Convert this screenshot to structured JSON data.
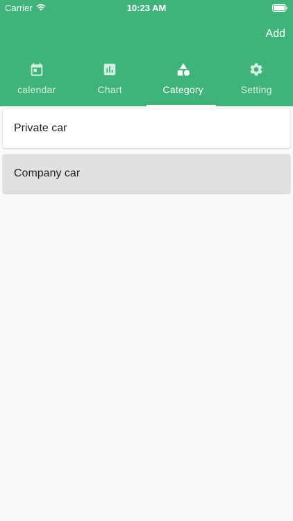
{
  "status_bar": {
    "carrier": "Carrier",
    "time": "10:23 AM"
  },
  "toolbar": {
    "add_label": "Add"
  },
  "tabs": [
    {
      "label": "calendar",
      "icon": "calendar-icon",
      "active": false
    },
    {
      "label": "Chart",
      "icon": "bar-chart-icon",
      "active": false
    },
    {
      "label": "Category",
      "icon": "shapes-icon",
      "active": true
    },
    {
      "label": "Setting",
      "icon": "gear-icon",
      "active": false
    }
  ],
  "categories": [
    {
      "label": "Private car",
      "selected": false
    },
    {
      "label": "Company car",
      "selected": true
    }
  ],
  "colors": {
    "header": "#3fb37a",
    "background": "#fafafa",
    "item": "#ffffff",
    "item_selected": "#e0e0e0"
  }
}
